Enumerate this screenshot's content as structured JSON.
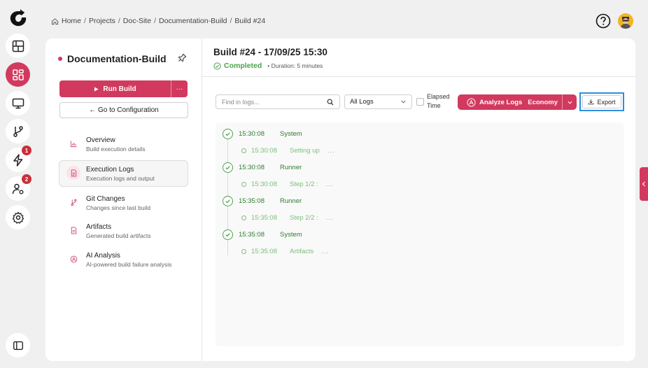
{
  "breadcrumb": {
    "items": [
      "Home",
      "Projects",
      "Doc-Site",
      "Documentation-Build",
      "Build #24"
    ],
    "separator": "/"
  },
  "rail": {
    "badges": {
      "lightning": "1",
      "users": "2"
    }
  },
  "project": {
    "title": "Documentation-Build",
    "run_label": "Run Build",
    "more_label": "···",
    "config_label": "← Go to Configuration"
  },
  "nav": {
    "items": [
      {
        "title": "Overview",
        "subtitle": "Build execution details"
      },
      {
        "title": "Execution Logs",
        "subtitle": "Execution logs and output"
      },
      {
        "title": "Git Changes",
        "subtitle": "Changes since last build"
      },
      {
        "title": "Artifacts",
        "subtitle": "Generated build artifacts"
      },
      {
        "title": "AI Analysis",
        "subtitle": "AI-powered build failure analysis"
      }
    ]
  },
  "build": {
    "title": "Build #24 - 17/09/25 15:30",
    "status": "Completed",
    "duration": "• Duration: 5 minutes"
  },
  "toolbar": {
    "search_placeholder": "Find in logs...",
    "filter_value": "All Logs",
    "elapsed_label_1": "Elapsed",
    "elapsed_label_2": "Time",
    "analyze_label": "Analyze Logs",
    "analyze_mode": "Economy",
    "export_label": "Export"
  },
  "logs": [
    {
      "time": "15:30:08",
      "source": "System",
      "sub_time": "15:30:08",
      "sub_text": "Setting up",
      "ellipsis": "..."
    },
    {
      "time": "15:30:08",
      "source": "Runner",
      "sub_time": "15:30:08",
      "sub_text": "Step 1/2 :",
      "ellipsis": "..."
    },
    {
      "time": "15:35:08",
      "source": "Runner",
      "sub_time": "15:35:08",
      "sub_text": "Step 2/2 :",
      "ellipsis": "..."
    },
    {
      "time": "15:35:08",
      "source": "System",
      "sub_time": "15:35:08",
      "sub_text": "Artifacts",
      "ellipsis": "..."
    }
  ],
  "colors": {
    "accent": "#d2395e",
    "success": "#4aa34a",
    "focus": "#2f8fe0"
  }
}
